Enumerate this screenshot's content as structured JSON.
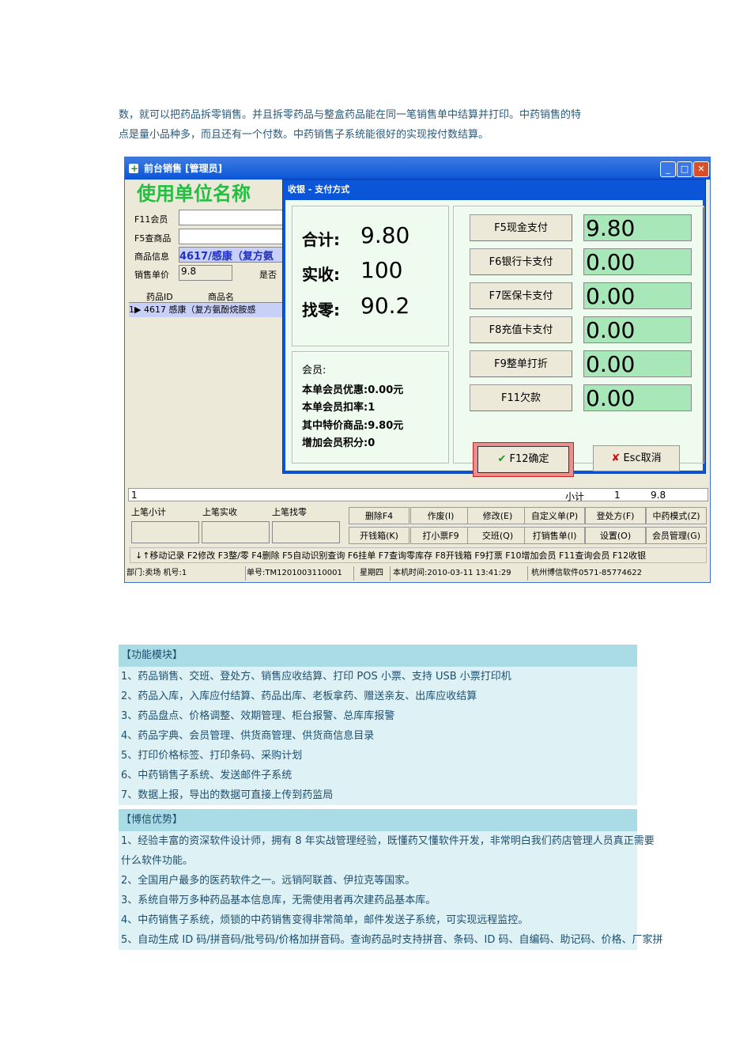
{
  "intro": [
    "数，就可以把药品拆零销售。并且拆零药品与整盒药品能在同一笔销售单中结算并打印。中药销售的特",
    "点是量小品种多，而且还有一个付数。中药销售子系统能很好的实现按付数结算。"
  ],
  "app": {
    "title": "前台销售 [管理员]",
    "unit_name": "使用单位名称",
    "labels": {
      "member": "F11会员",
      "search": "F5查商品",
      "info": "商品信息",
      "price": "销售单价",
      "is_special": "是否"
    },
    "info_value": "4617/感康（复方氨",
    "price_value": "9.8",
    "grid_headers": [
      "药品ID",
      "商品名"
    ],
    "grid_row": {
      "index": "1",
      "id": "4617",
      "name": "感康（复方氨酚烷胺感"
    },
    "sum_row": {
      "index": "1",
      "label": "小计",
      "qty": "1",
      "amount": "9.8"
    },
    "last": {
      "subtotal": "上笔小计",
      "received": "上笔实收",
      "change": "上笔找零"
    },
    "buttons": [
      "删除F4",
      "作废(I)",
      "修改(E)",
      "自定义单(P)",
      "登处方(F)",
      "中药模式(Z)",
      "开钱箱(K)",
      "打小票F9",
      "交班(Q)",
      "打销售单(I)",
      "设置(O)",
      "会员管理(G)"
    ],
    "hotkeys": "↓↑移动记录  F2修改  F3整/零  F4删除  F5自动识别查询  F6挂单  F7查询零库存  F8开钱箱  F9打票  F10增加会员  F11查询会员  F12收银",
    "status": {
      "dept": "部门:卖场 机号:1",
      "order": "单号:TM1201003110001",
      "weekday": "星期四",
      "time": "本机时间:2010-03-11 13:41:29",
      "company": "杭州博信软件0571-85774622"
    }
  },
  "dialog": {
    "title": "收银 - 支付方式",
    "total_label": "合计:",
    "total": "9.80",
    "received_label": "实收:",
    "received": "100",
    "change_label": "找零:",
    "change": "90.2",
    "member": [
      "会员:",
      "本单会员优惠:0.00元",
      "本单会员扣率:1",
      "其中特价商品:9.80元",
      "增加会员积分:0"
    ],
    "payments": [
      {
        "label": "F5现金支付",
        "value": "9.80"
      },
      {
        "label": "F6银行卡支付",
        "value": "0.00"
      },
      {
        "label": "F7医保卡支付",
        "value": "0.00"
      },
      {
        "label": "F8充值卡支付",
        "value": "0.00"
      },
      {
        "label": "F9整单打折",
        "value": "0.00"
      },
      {
        "label": "F11欠款",
        "value": "0.00"
      }
    ],
    "ok": "F12确定",
    "cancel": "Esc取消"
  },
  "features": {
    "title": "【功能模块】",
    "items": [
      "1、药品销售、交班、登处方、销售应收结算、打印 POS 小票、支持 USB 小票打印机",
      "2、药品入库，入库应付结算、药品出库、老板拿药、赠送亲友、出库应收结算",
      "3、药品盘点、价格调整、效期管理、柜台报警、总库库报警",
      "4、药品字典、会员管理、供货商管理、供货商信息目录",
      "5、打印价格标签、打印条码、采购计划",
      "6、中药销售子系统、发送邮件子系统",
      "7、数据上报，导出的数据可直接上传到药监局"
    ]
  },
  "advantages": {
    "title": "【博信优势】",
    "items": [
      "1、经验丰富的资深软件设计师，拥有 8 年实战管理经验，既懂药又懂软件开发，非常明白我们药店管理人员真正需要",
      "什么软件功能。",
      "2、全国用户最多的医药软件之一。远销阿联酋、伊拉克等国家。",
      "3、系统自带万多种药品基本信息库，无需使用者再次建药品基本库。",
      "4、中药销售子系统，烦锁的中药销售变得非常简单，邮件发送子系统，可实现远程监控。",
      "5、自动生成 ID 码/拼音码/批号码/价格加拼音码。查询药品时支持拼音、条码、ID 码、自编码、助记码、价格、厂家拼"
    ]
  }
}
